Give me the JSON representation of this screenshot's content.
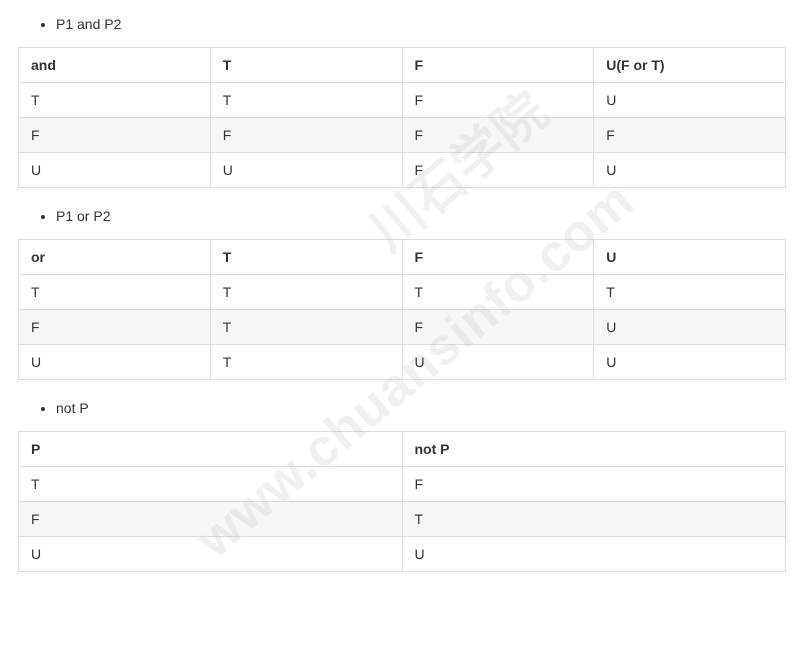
{
  "sections": [
    {
      "bullet": "P1 and P2",
      "headers": [
        "and",
        "T",
        "F",
        "U(F or T)"
      ],
      "rows": [
        [
          "T",
          "T",
          "F",
          "U"
        ],
        [
          "F",
          "F",
          "F",
          "F"
        ],
        [
          "U",
          "U",
          "F",
          "U"
        ]
      ]
    },
    {
      "bullet": "P1 or P2",
      "headers": [
        "or",
        "T",
        "F",
        "U"
      ],
      "rows": [
        [
          "T",
          "T",
          "T",
          "T"
        ],
        [
          "F",
          "T",
          "F",
          "U"
        ],
        [
          "U",
          "T",
          "U",
          "U"
        ]
      ]
    },
    {
      "bullet": "not P",
      "headers": [
        "P",
        "not P"
      ],
      "rows": [
        [
          "T",
          "F"
        ],
        [
          "F",
          "T"
        ],
        [
          "U",
          "U"
        ]
      ]
    }
  ],
  "watermarks": {
    "wm1": "川石学院",
    "wm2": "www.chuansinfo.com"
  }
}
